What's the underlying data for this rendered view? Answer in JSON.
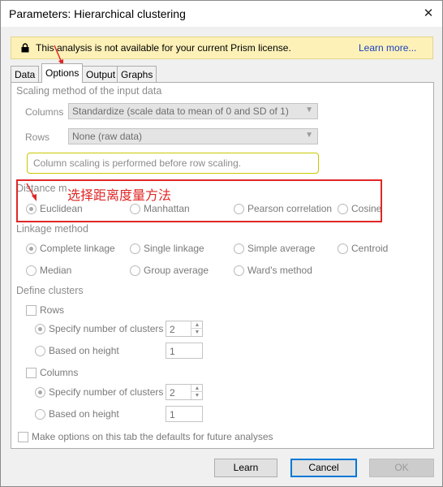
{
  "window": {
    "title": "Parameters: Hierarchical clustering",
    "close_glyph": "✕"
  },
  "license_bar": {
    "message": "This analysis is not available for your current Prism license.",
    "link": "Learn more..."
  },
  "tabs": [
    {
      "label": "Data",
      "active": false
    },
    {
      "label": "Options",
      "active": true
    },
    {
      "label": "Output",
      "active": false
    },
    {
      "label": "Graphs",
      "active": false
    }
  ],
  "scaling": {
    "heading": "Scaling method of the input data",
    "columns_label": "Columns",
    "columns_value": "Standardize (scale data to mean of 0 and SD of 1)",
    "rows_label": "Rows",
    "rows_value": "None (raw data)",
    "note": "Column scaling is performed before row scaling."
  },
  "distance": {
    "heading": "Distance m",
    "options": [
      "Euclidean",
      "Manhattan",
      "Pearson correlation",
      "Cosine"
    ],
    "selected": "Euclidean"
  },
  "annotation": {
    "text": "选择距离度量方法",
    "color": "#e02727"
  },
  "linkage": {
    "heading": "Linkage method",
    "options": [
      "Complete linkage",
      "Single linkage",
      "Simple average",
      "Centroid",
      "Median",
      "Group average",
      "Ward's method"
    ],
    "selected": "Complete linkage"
  },
  "clusters": {
    "heading": "Define clusters",
    "rows": {
      "label": "Rows",
      "specify_label": "Specify number of clusters",
      "specify_value": "2",
      "height_label": "Based on height",
      "height_value": "1"
    },
    "columns": {
      "label": "Columns",
      "specify_label": "Specify number of clusters",
      "specify_value": "2",
      "height_label": "Based on height",
      "height_value": "1"
    }
  },
  "defaults_checkbox": "Make options on this tab the defaults for future analyses",
  "buttons": {
    "learn": "Learn",
    "cancel": "Cancel",
    "ok": "OK"
  },
  "colors": {
    "accent": "#0078d7",
    "license_bg": "#fdf1b8",
    "link": "#1a3fbf",
    "annotation": "#e02727"
  },
  "icons": {
    "lock": "lock-icon",
    "close": "close-icon",
    "arrow": "arrow-icon"
  }
}
